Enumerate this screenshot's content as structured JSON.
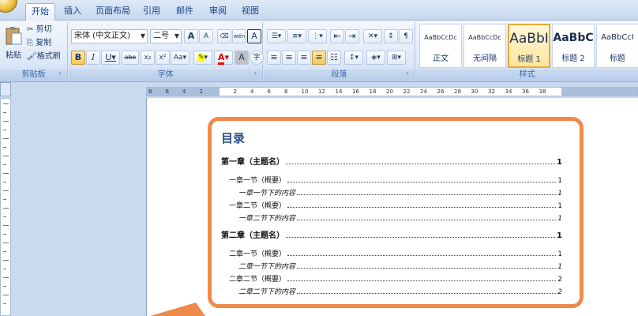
{
  "tabs": [
    {
      "label": "开始",
      "active": true
    },
    {
      "label": "插入"
    },
    {
      "label": "页面布局"
    },
    {
      "label": "引用"
    },
    {
      "label": "邮件"
    },
    {
      "label": "审阅"
    },
    {
      "label": "视图"
    }
  ],
  "clipboard": {
    "paste": "粘贴",
    "cut": "剪切",
    "copy": "复制",
    "format_painter": "格式刷",
    "group_label": "剪贴板"
  },
  "font": {
    "name": "宋体 (中文正文)",
    "size": "二号",
    "grow": "A",
    "shrink": "A",
    "phonetic": "wén",
    "border_char": "A",
    "bold": "B",
    "italic": "I",
    "underline": "U",
    "strike": "abe",
    "subscript": "x₂",
    "superscript": "x²",
    "change_case": "Aa",
    "font_color": "A",
    "char_shading": "A",
    "enclose": "字",
    "group_label": "字体"
  },
  "paragraph": {
    "group_label": "段落"
  },
  "styles": {
    "items": [
      {
        "sample": "AaBbCcDc",
        "name": "正文"
      },
      {
        "sample": "AaBbCcDc",
        "name": "无间隔"
      },
      {
        "sample": "AaBbI",
        "name": "标题 1",
        "selected": true
      },
      {
        "sample": "AaBbC",
        "name": "标题 2"
      },
      {
        "sample": "AaBbCcI",
        "name": "标题"
      }
    ],
    "group_label": "样式"
  },
  "ruler": {
    "ticks": [
      "8",
      "6",
      "4",
      "2",
      "",
      "2",
      "4",
      "6",
      "8",
      "10",
      "12",
      "14",
      "16",
      "18",
      "20",
      "22",
      "24",
      "26",
      "28",
      "30",
      "32",
      "34",
      "36",
      "38"
    ]
  },
  "document": {
    "toc_title": "目录",
    "entries": [
      {
        "text": "第一章（主题名）",
        "page": "1",
        "level": 1
      },
      {
        "text": "一章一节（概要）",
        "page": "1",
        "level": 2
      },
      {
        "text": "一章一节下的内容",
        "page": "1",
        "level": 3
      },
      {
        "text": "一章二节（概要）",
        "page": "1",
        "level": 2
      },
      {
        "text": "一章二节下的内容",
        "page": "1",
        "level": 3
      },
      {
        "text": "第二章（主题名）",
        "page": "1",
        "level": 1
      },
      {
        "text": "二章一节（概要）",
        "page": "1",
        "level": 2
      },
      {
        "text": "二章一节下的内容",
        "page": "1",
        "level": 3
      },
      {
        "text": "二章二节（概要）",
        "page": "2",
        "level": 2
      },
      {
        "text": "二章二节下的内容",
        "page": "2",
        "level": 3
      }
    ]
  },
  "colors": {
    "accent": "#ef8a4a",
    "ribbon": "#dce8f7",
    "title": "#2a4f8c"
  }
}
